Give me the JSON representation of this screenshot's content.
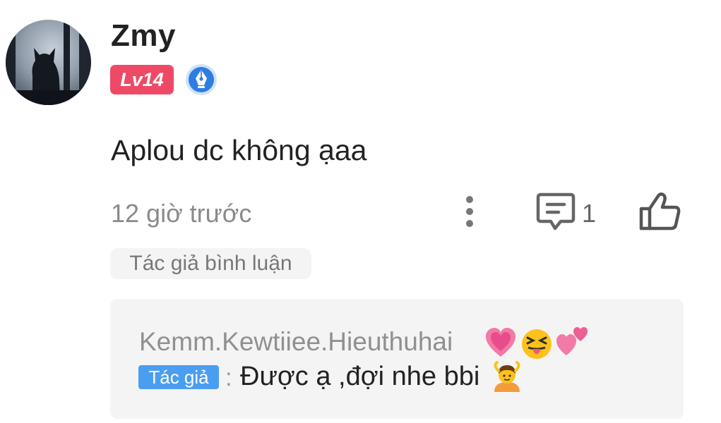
{
  "user": {
    "name": "Zmy",
    "level": "Lv14",
    "badge_icon": "pen-nib-badge-icon"
  },
  "comment": {
    "text": "Aplou dc không ạaa",
    "time": "12 giờ trước",
    "reply_count": "1",
    "author_tag": "Tác giả bình luận"
  },
  "reply": {
    "name": "Kemm.Kewtiiee.Hieuthuhai",
    "name_emojis": [
      "growing-heart-emoji",
      "squinting-tongue-emoji",
      "revolving-hearts-emoji"
    ],
    "author_tag": "Tác giả",
    "colon": ":",
    "text": "Được ạ ,đợi nhe bbi",
    "text_emoji": "person-gesturing-ok-emoji"
  },
  "colors": {
    "level_badge": "#ee4a66",
    "author_tag_blue": "#4a9ef0",
    "badge_blue": "#2f7de0",
    "muted_text": "#8a8a8a",
    "reply_bg": "#f4f4f4"
  },
  "icons": {
    "more": "vertical-dots-icon",
    "reply": "comment-bubble-icon",
    "like": "thumbs-up-icon"
  }
}
